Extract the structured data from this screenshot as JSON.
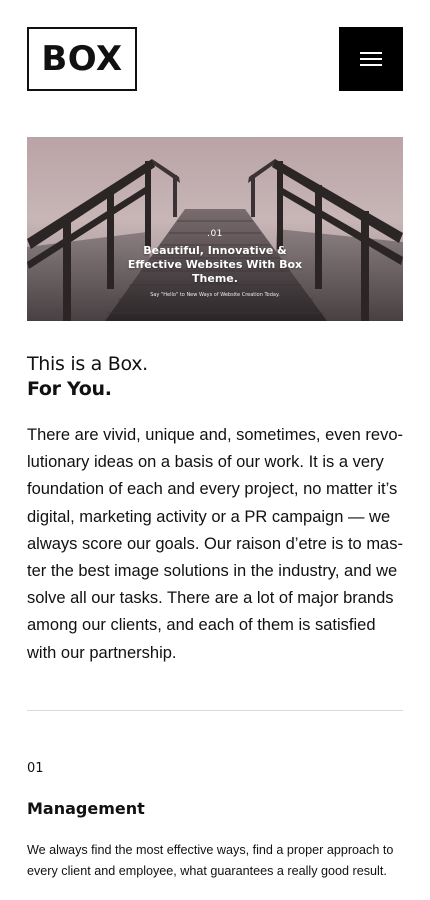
{
  "header": {
    "logo_text": "BOX",
    "menu_icon": "hamburger-menu-icon"
  },
  "hero": {
    "number": ".01",
    "title": "Beautiful, Innovative & Effective Websites With Box Theme.",
    "subtitle": "Say \"Hello\" to New Ways of Website Creation Today."
  },
  "intro": {
    "line1": "This is a Box.",
    "line2": "For You."
  },
  "body": {
    "paragraph": "There are vivid, unique and, sometimes, even revo-lutionary ideas on a basis of our work. It is a very foundation of each and every project, no matter it’s digital, marketing activity or a PR campaign — we always score our goals. Our raison d’etre is to mas-ter the best image solutions in the industry, and we solve all our tasks. There are a lot of major brands among our clients, and each of them is satisfied with our partnership."
  },
  "feature": {
    "number": "01",
    "title": "Management",
    "description": "We always find the most effective ways, find a proper approach to every client and employee, what guarantees a really good result."
  },
  "colors": {
    "text": "#111111",
    "menu_background": "#000000",
    "divider": "#d9d9d9"
  }
}
